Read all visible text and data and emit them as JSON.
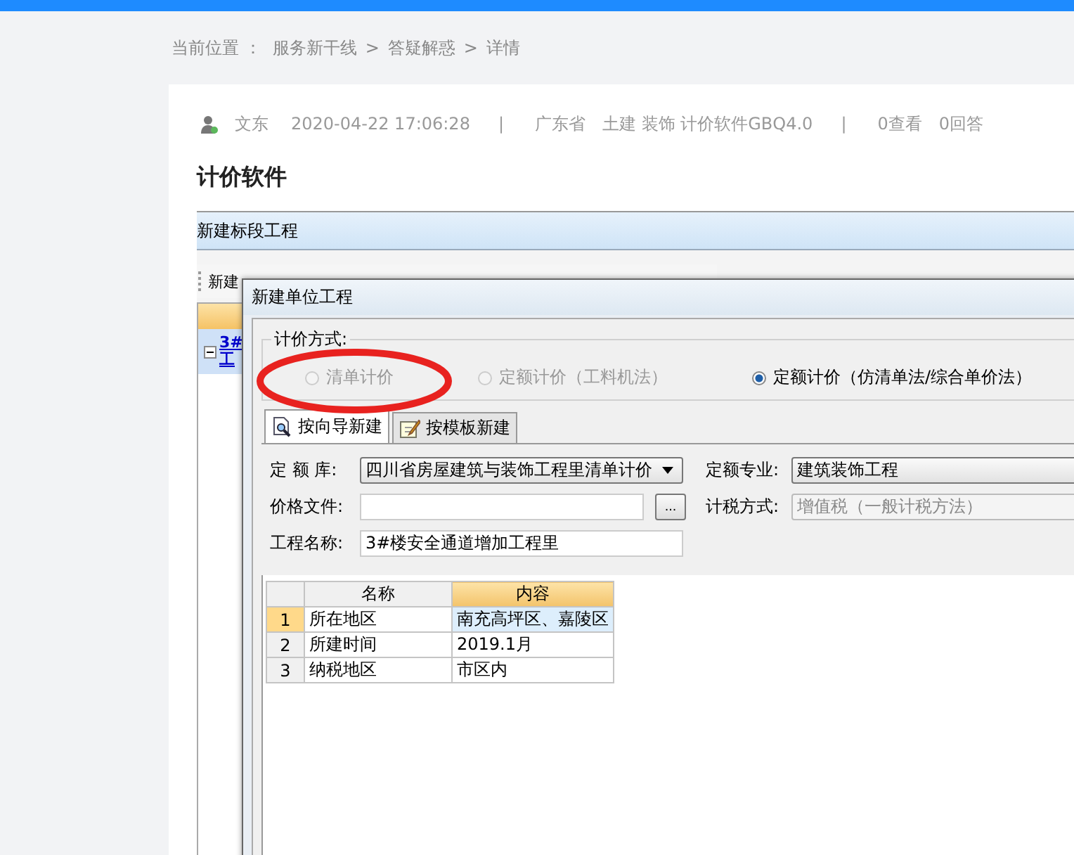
{
  "breadcrumb": {
    "label": "当前位置 ：",
    "separator": ">",
    "items": [
      "服务新干线",
      "答疑解惑",
      "详情"
    ]
  },
  "meta": [
    {
      "kind": "author",
      "text": "文东"
    },
    {
      "kind": "text",
      "text": "2020-04-22 17:06:28"
    },
    {
      "kind": "divider",
      "text": "|"
    },
    {
      "kind": "text",
      "text": "广东省"
    },
    {
      "kind": "text",
      "text": "土建 装饰 计价软件GBQ4.0"
    },
    {
      "kind": "divider",
      "text": "|"
    },
    {
      "kind": "text",
      "text": "0查看"
    },
    {
      "kind": "text",
      "text": "0回答"
    }
  ],
  "title": "计价软件",
  "screenshot": {
    "window": {
      "title": "新建标段工程",
      "toolbar": [
        "新建"
      ],
      "tree": [
        {
          "label": "3#",
          "sub": "工",
          "selected": true,
          "expanded": true
        }
      ]
    },
    "dialog": {
      "title": "新建单位工程",
      "group_label": "计价方式:",
      "radios": [
        {
          "label": "清单计价",
          "selected": false,
          "disabled": true,
          "circled": true
        },
        {
          "label": "定额计价（工料机法）",
          "selected": false,
          "disabled": true,
          "circled": false
        },
        {
          "label": "定额计价（仿清单法/综合单价法）",
          "selected": true,
          "disabled": false,
          "circled": false
        }
      ],
      "tabs": [
        {
          "label": "按向导新建",
          "kind": "wizard",
          "selected": true
        },
        {
          "label": "按模板新建",
          "kind": "template",
          "selected": false
        }
      ],
      "fields": [
        {
          "kind": "select",
          "label": "定 额 库:",
          "value": "四川省房屋建筑与装饰工程里清单计价",
          "disabled": false
        },
        {
          "kind": "select-wide",
          "label": "定额专业:",
          "value": "建筑装饰工程",
          "disabled": false
        },
        {
          "kind": "file",
          "label": "价格文件:",
          "button": "...",
          "disabled": false
        },
        {
          "kind": "select-wide",
          "label": "计税方式:",
          "value": "增值税（一般计税方法）",
          "disabled": true
        },
        {
          "kind": "input",
          "label": "工程名称:",
          "value": "3#楼安全通道增加工程里",
          "disabled": false
        }
      ],
      "table": {
        "columns": [
          {
            "label": "名称",
            "selected": false
          },
          {
            "label": "内容",
            "selected": true
          }
        ],
        "rows": [
          {
            "num": "1",
            "name": "所在地区",
            "content": "南充高坪区、嘉陵区",
            "selected": true
          },
          {
            "num": "2",
            "name": "所建时间",
            "content": "2019.1月",
            "selected": false
          },
          {
            "num": "3",
            "name": "纳税地区",
            "content": "市区内",
            "selected": false
          }
        ]
      }
    }
  }
}
